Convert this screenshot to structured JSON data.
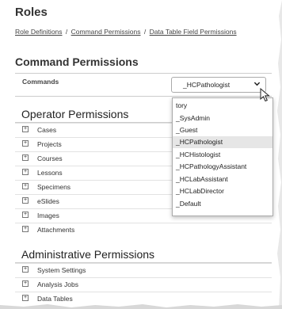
{
  "page": {
    "title": "Roles",
    "breadcrumb": [
      {
        "label": "Role Definitions"
      },
      {
        "label": "Command Permissions"
      },
      {
        "label": "Data Table Field Permissions"
      }
    ],
    "breadcrumb_separator": "/"
  },
  "command_permissions": {
    "title": "Command Permissions",
    "header_label": "Commands",
    "selected_role": "_HCPathologist",
    "chevron_icon": "chevron-down-icon",
    "dropdown_options": [
      "tory",
      "_SysAdmin",
      "_Guest",
      "_HCPathologist",
      "_HCHistologist",
      "_HCPathologyAssistant",
      "_HCLabAssistant",
      "_HCLabDirector",
      "_Default"
    ],
    "selected_option_index": 3
  },
  "operator_permissions": {
    "title": "Operator Permissions",
    "expand_icon": "⊞",
    "items": [
      "Cases",
      "Projects",
      "Courses",
      "Lessons",
      "Specimens",
      "eSlides",
      "Images",
      "Attachments"
    ]
  },
  "administrative_permissions": {
    "title": "Administrative Permissions",
    "expand_icon": "⊞",
    "items": [
      "System Settings",
      "Analysis Jobs",
      "Data Tables"
    ]
  }
}
